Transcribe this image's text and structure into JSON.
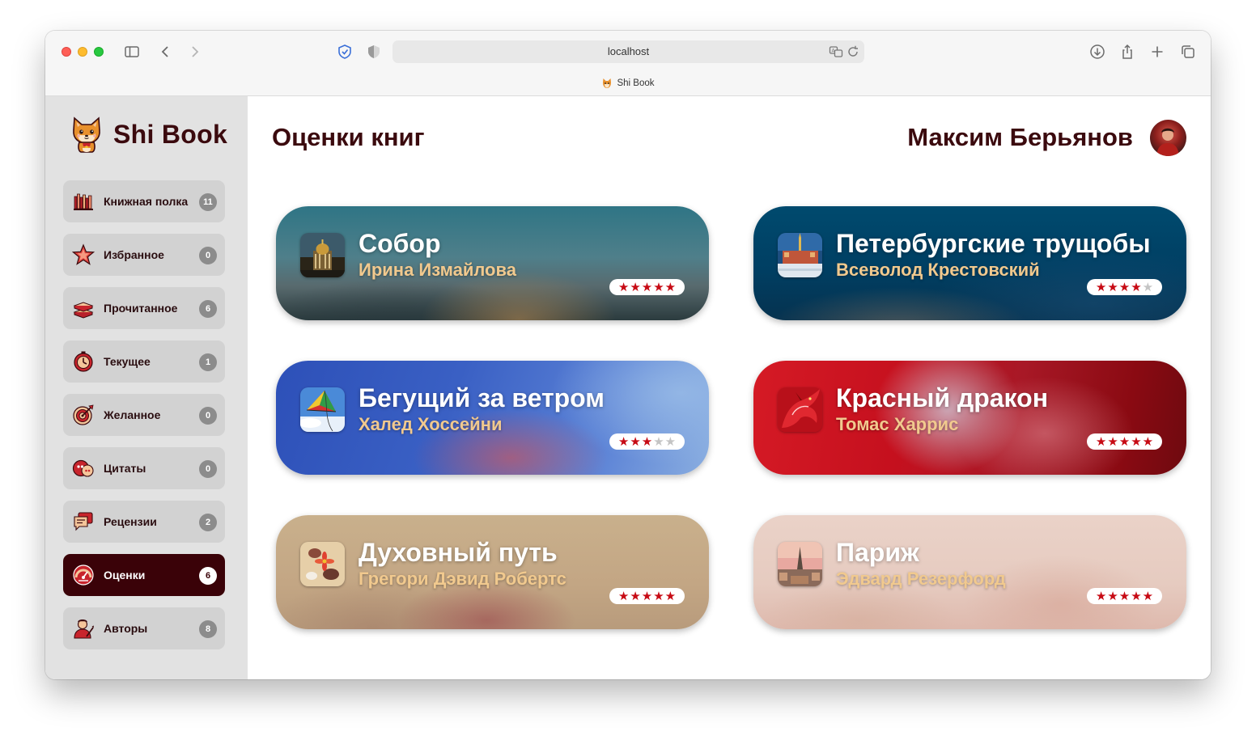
{
  "browser": {
    "url": "localhost",
    "tab_title": "Shi Book"
  },
  "app": {
    "name": "Shi Book",
    "logo_icon": "shiba-dog-icon"
  },
  "sidebar": {
    "items": [
      {
        "label": "Книжная полка",
        "count": "11",
        "icon": "bookshelf-icon"
      },
      {
        "label": "Избранное",
        "count": "0",
        "icon": "star-icon"
      },
      {
        "label": "Прочитанное",
        "count": "6",
        "icon": "books-stack-icon"
      },
      {
        "label": "Текущее",
        "count": "1",
        "icon": "timer-icon"
      },
      {
        "label": "Желанное",
        "count": "0",
        "icon": "target-icon"
      },
      {
        "label": "Цитаты",
        "count": "0",
        "icon": "quote-bubbles-icon"
      },
      {
        "label": "Рецензии",
        "count": "2",
        "icon": "reviews-icon"
      },
      {
        "label": "Оценки",
        "count": "6",
        "icon": "rating-gauge-icon",
        "active": true
      },
      {
        "label": "Авторы",
        "count": "8",
        "icon": "author-icon"
      }
    ]
  },
  "header": {
    "title": "Оценки книг",
    "user_name": "Максим Берьянов"
  },
  "books": [
    {
      "title": "Собор",
      "author": "Ирина Измайлова",
      "rating": 5,
      "max": 5
    },
    {
      "title": "Петербургские трущобы",
      "author": "Всеволод Крестовский",
      "rating": 4,
      "max": 5
    },
    {
      "title": "Бегущий за ветром",
      "author": "Халед Хоссейни",
      "rating": 3,
      "max": 5
    },
    {
      "title": "Красный дракон",
      "author": "Томас Харрис",
      "rating": 5,
      "max": 5
    },
    {
      "title": "Духовный путь",
      "author": "Грегори Дэвид Робертс",
      "rating": 5,
      "max": 5
    },
    {
      "title": "Париж",
      "author": "Эдвард Резерфорд",
      "rating": 5,
      "max": 5
    }
  ],
  "colors": {
    "brand": "#3b0a0e",
    "active_nav": "#3a0208",
    "star": "#c70a14",
    "author_text": "#f1c98e"
  }
}
